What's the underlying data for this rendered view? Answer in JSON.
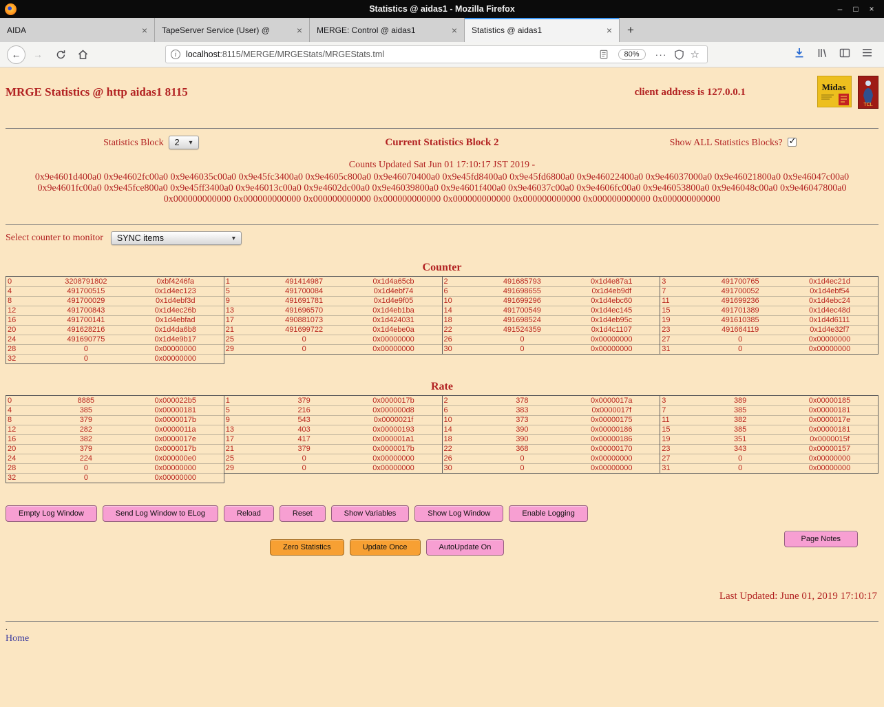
{
  "window": {
    "title": "Statistics @ aidas1 - Mozilla Firefox"
  },
  "icons": {
    "close": "×",
    "new_tab": "+",
    "back": "←",
    "forward": "→",
    "info": "i",
    "more": "···",
    "star": "☆",
    "minimize": "–",
    "maximize": "□",
    "close_window": "×",
    "dropdown": "▾",
    "check": "✓"
  },
  "tabs": [
    {
      "label": "AIDA",
      "active": false
    },
    {
      "label": "TapeServer Service (User) @",
      "active": false
    },
    {
      "label": "MERGE: Control @ aidas1",
      "active": false
    },
    {
      "label": "Statistics @ aidas1",
      "active": true
    }
  ],
  "nav": {
    "url_host": "localhost",
    "url_path": ":8115/MERGE/MRGEStats/MRGEStats.tml",
    "zoom": "80%"
  },
  "page": {
    "title": "MRGE Statistics @ http aidas1 8115",
    "client": "client address is 127.0.0.1",
    "logos": {
      "midas": "Midas",
      "tcl": "TCL"
    },
    "stats_block_label": "Statistics Block",
    "stats_block_value": "2",
    "current_block": "Current Statistics Block 2",
    "show_all_label": "Show ALL Statistics Blocks?",
    "counts_updated": "Counts Updated Sat Jun 01 17:10:17 JST 2019 -",
    "addresses": "0x9e4601d400a0 0x9e4602fc00a0 0x9e46035c00a0 0x9e45fc3400a0 0x9e4605c800a0 0x9e46070400a0 0x9e45fd8400a0 0x9e45fd6800a0 0x9e46022400a0 0x9e46037000a0 0x9e46021800a0 0x9e46047c00a0 0x9e4601fc00a0 0x9e45fce800a0 0x9e45ff3400a0 0x9e46013c00a0 0x9e4602dc00a0 0x9e46039800a0 0x9e4601f400a0 0x9e46037c00a0 0x9e4606fc00a0 0x9e46053800a0 0x9e46048c00a0 0x9e46047800a0 0x000000000000 0x000000000000 0x000000000000 0x000000000000 0x000000000000 0x000000000000 0x000000000000 0x000000000000",
    "select_counter_label": "Select counter to monitor",
    "counter_select_value": "SYNC items",
    "counter_heading": "Counter",
    "rate_heading": "Rate",
    "buttons_row1": [
      {
        "label": "Empty Log Window",
        "style": "pink"
      },
      {
        "label": "Send Log Window to ELog",
        "style": "pink"
      },
      {
        "label": "Reload",
        "style": "pink"
      },
      {
        "label": "Reset",
        "style": "pink"
      },
      {
        "label": "Show Variables",
        "style": "pink"
      },
      {
        "label": "Show Log Window",
        "style": "pink"
      },
      {
        "label": "Enable Logging",
        "style": "pink"
      }
    ],
    "buttons_row2": [
      {
        "label": "Zero Statistics",
        "style": "orange"
      },
      {
        "label": "Update Once",
        "style": "orange"
      },
      {
        "label": "AutoUpdate On",
        "style": "pink"
      }
    ],
    "page_notes": "Page Notes",
    "last_updated": "Last Updated: June 01, 2019 17:10:17",
    "dot": ".",
    "home_label": "Home"
  },
  "counter_table": [
    [
      [
        "0",
        "3208791802",
        "0xbf4246fa"
      ],
      [
        "4",
        "491700515",
        "0x1d4ec123"
      ],
      [
        "8",
        "491700029",
        "0x1d4ebf3d"
      ],
      [
        "12",
        "491700843",
        "0x1d4ec26b"
      ],
      [
        "16",
        "491700141",
        "0x1d4ebfad"
      ],
      [
        "20",
        "491628216",
        "0x1d4da6b8"
      ],
      [
        "24",
        "491690775",
        "0x1d4e9b17"
      ],
      [
        "28",
        "0",
        "0x00000000"
      ],
      [
        "32",
        "0",
        "0x00000000"
      ]
    ],
    [
      [
        "1",
        "491414987",
        "0x1d4a65cb"
      ],
      [
        "5",
        "491700084",
        "0x1d4ebf74"
      ],
      [
        "9",
        "491691781",
        "0x1d4e9f05"
      ],
      [
        "13",
        "491696570",
        "0x1d4eb1ba"
      ],
      [
        "17",
        "490881073",
        "0x1d424031"
      ],
      [
        "21",
        "491699722",
        "0x1d4ebe0a"
      ],
      [
        "25",
        "0",
        "0x00000000"
      ],
      [
        "29",
        "0",
        "0x00000000"
      ]
    ],
    [
      [
        "2",
        "491685793",
        "0x1d4e87a1"
      ],
      [
        "6",
        "491698655",
        "0x1d4eb9df"
      ],
      [
        "10",
        "491699296",
        "0x1d4ebc60"
      ],
      [
        "14",
        "491700549",
        "0x1d4ec145"
      ],
      [
        "18",
        "491698524",
        "0x1d4eb95c"
      ],
      [
        "22",
        "491524359",
        "0x1d4c1107"
      ],
      [
        "26",
        "0",
        "0x00000000"
      ],
      [
        "30",
        "0",
        "0x00000000"
      ]
    ],
    [
      [
        "3",
        "491700765",
        "0x1d4ec21d"
      ],
      [
        "7",
        "491700052",
        "0x1d4ebf54"
      ],
      [
        "11",
        "491699236",
        "0x1d4ebc24"
      ],
      [
        "15",
        "491701389",
        "0x1d4ec48d"
      ],
      [
        "19",
        "491610385",
        "0x1d4d6111"
      ],
      [
        "23",
        "491664119",
        "0x1d4e32f7"
      ],
      [
        "27",
        "0",
        "0x00000000"
      ],
      [
        "31",
        "0",
        "0x00000000"
      ]
    ]
  ],
  "rate_table": [
    [
      [
        "0",
        "8885",
        "0x000022b5"
      ],
      [
        "4",
        "385",
        "0x00000181"
      ],
      [
        "8",
        "379",
        "0x0000017b"
      ],
      [
        "12",
        "282",
        "0x0000011a"
      ],
      [
        "16",
        "382",
        "0x0000017e"
      ],
      [
        "20",
        "379",
        "0x0000017b"
      ],
      [
        "24",
        "224",
        "0x000000e0"
      ],
      [
        "28",
        "0",
        "0x00000000"
      ],
      [
        "32",
        "0",
        "0x00000000"
      ]
    ],
    [
      [
        "1",
        "379",
        "0x0000017b"
      ],
      [
        "5",
        "216",
        "0x000000d8"
      ],
      [
        "9",
        "543",
        "0x0000021f"
      ],
      [
        "13",
        "403",
        "0x00000193"
      ],
      [
        "17",
        "417",
        "0x000001a1"
      ],
      [
        "21",
        "379",
        "0x0000017b"
      ],
      [
        "25",
        "0",
        "0x00000000"
      ],
      [
        "29",
        "0",
        "0x00000000"
      ]
    ],
    [
      [
        "2",
        "378",
        "0x0000017a"
      ],
      [
        "6",
        "383",
        "0x0000017f"
      ],
      [
        "10",
        "373",
        "0x00000175"
      ],
      [
        "14",
        "390",
        "0x00000186"
      ],
      [
        "18",
        "390",
        "0x00000186"
      ],
      [
        "22",
        "368",
        "0x00000170"
      ],
      [
        "26",
        "0",
        "0x00000000"
      ],
      [
        "30",
        "0",
        "0x00000000"
      ]
    ],
    [
      [
        "3",
        "389",
        "0x00000185"
      ],
      [
        "7",
        "385",
        "0x00000181"
      ],
      [
        "11",
        "382",
        "0x0000017e"
      ],
      [
        "15",
        "385",
        "0x00000181"
      ],
      [
        "19",
        "351",
        "0x0000015f"
      ],
      [
        "23",
        "343",
        "0x00000157"
      ],
      [
        "27",
        "0",
        "0x00000000"
      ],
      [
        "31",
        "0",
        "0x00000000"
      ]
    ]
  ]
}
